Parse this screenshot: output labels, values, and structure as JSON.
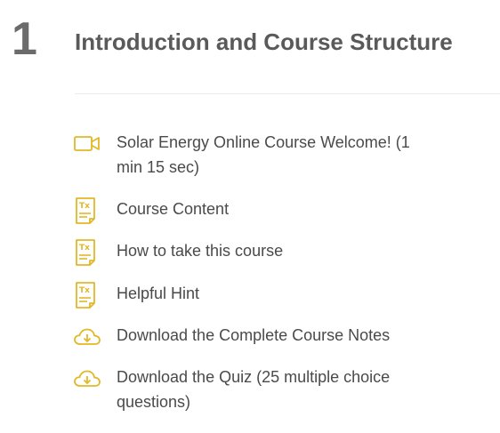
{
  "section": {
    "number": "1",
    "title": "Introduction and Course Structure"
  },
  "colors": {
    "icon": "#e2b826",
    "text": "#4a4a4a",
    "number": "#6b6b6b",
    "divider": "#ececec"
  },
  "lessons": [
    {
      "icon": "video-icon",
      "label": "Solar Energy Online Course Welcome! (1 min 15 sec)"
    },
    {
      "icon": "text-document-icon",
      "label": "Course Content"
    },
    {
      "icon": "text-document-icon",
      "label": "How to take this course"
    },
    {
      "icon": "text-document-icon",
      "label": "Helpful Hint"
    },
    {
      "icon": "cloud-download-icon",
      "label": "Download the Complete Course Notes"
    },
    {
      "icon": "cloud-download-icon",
      "label": "Download the Quiz (25 multiple choice questions)"
    }
  ]
}
